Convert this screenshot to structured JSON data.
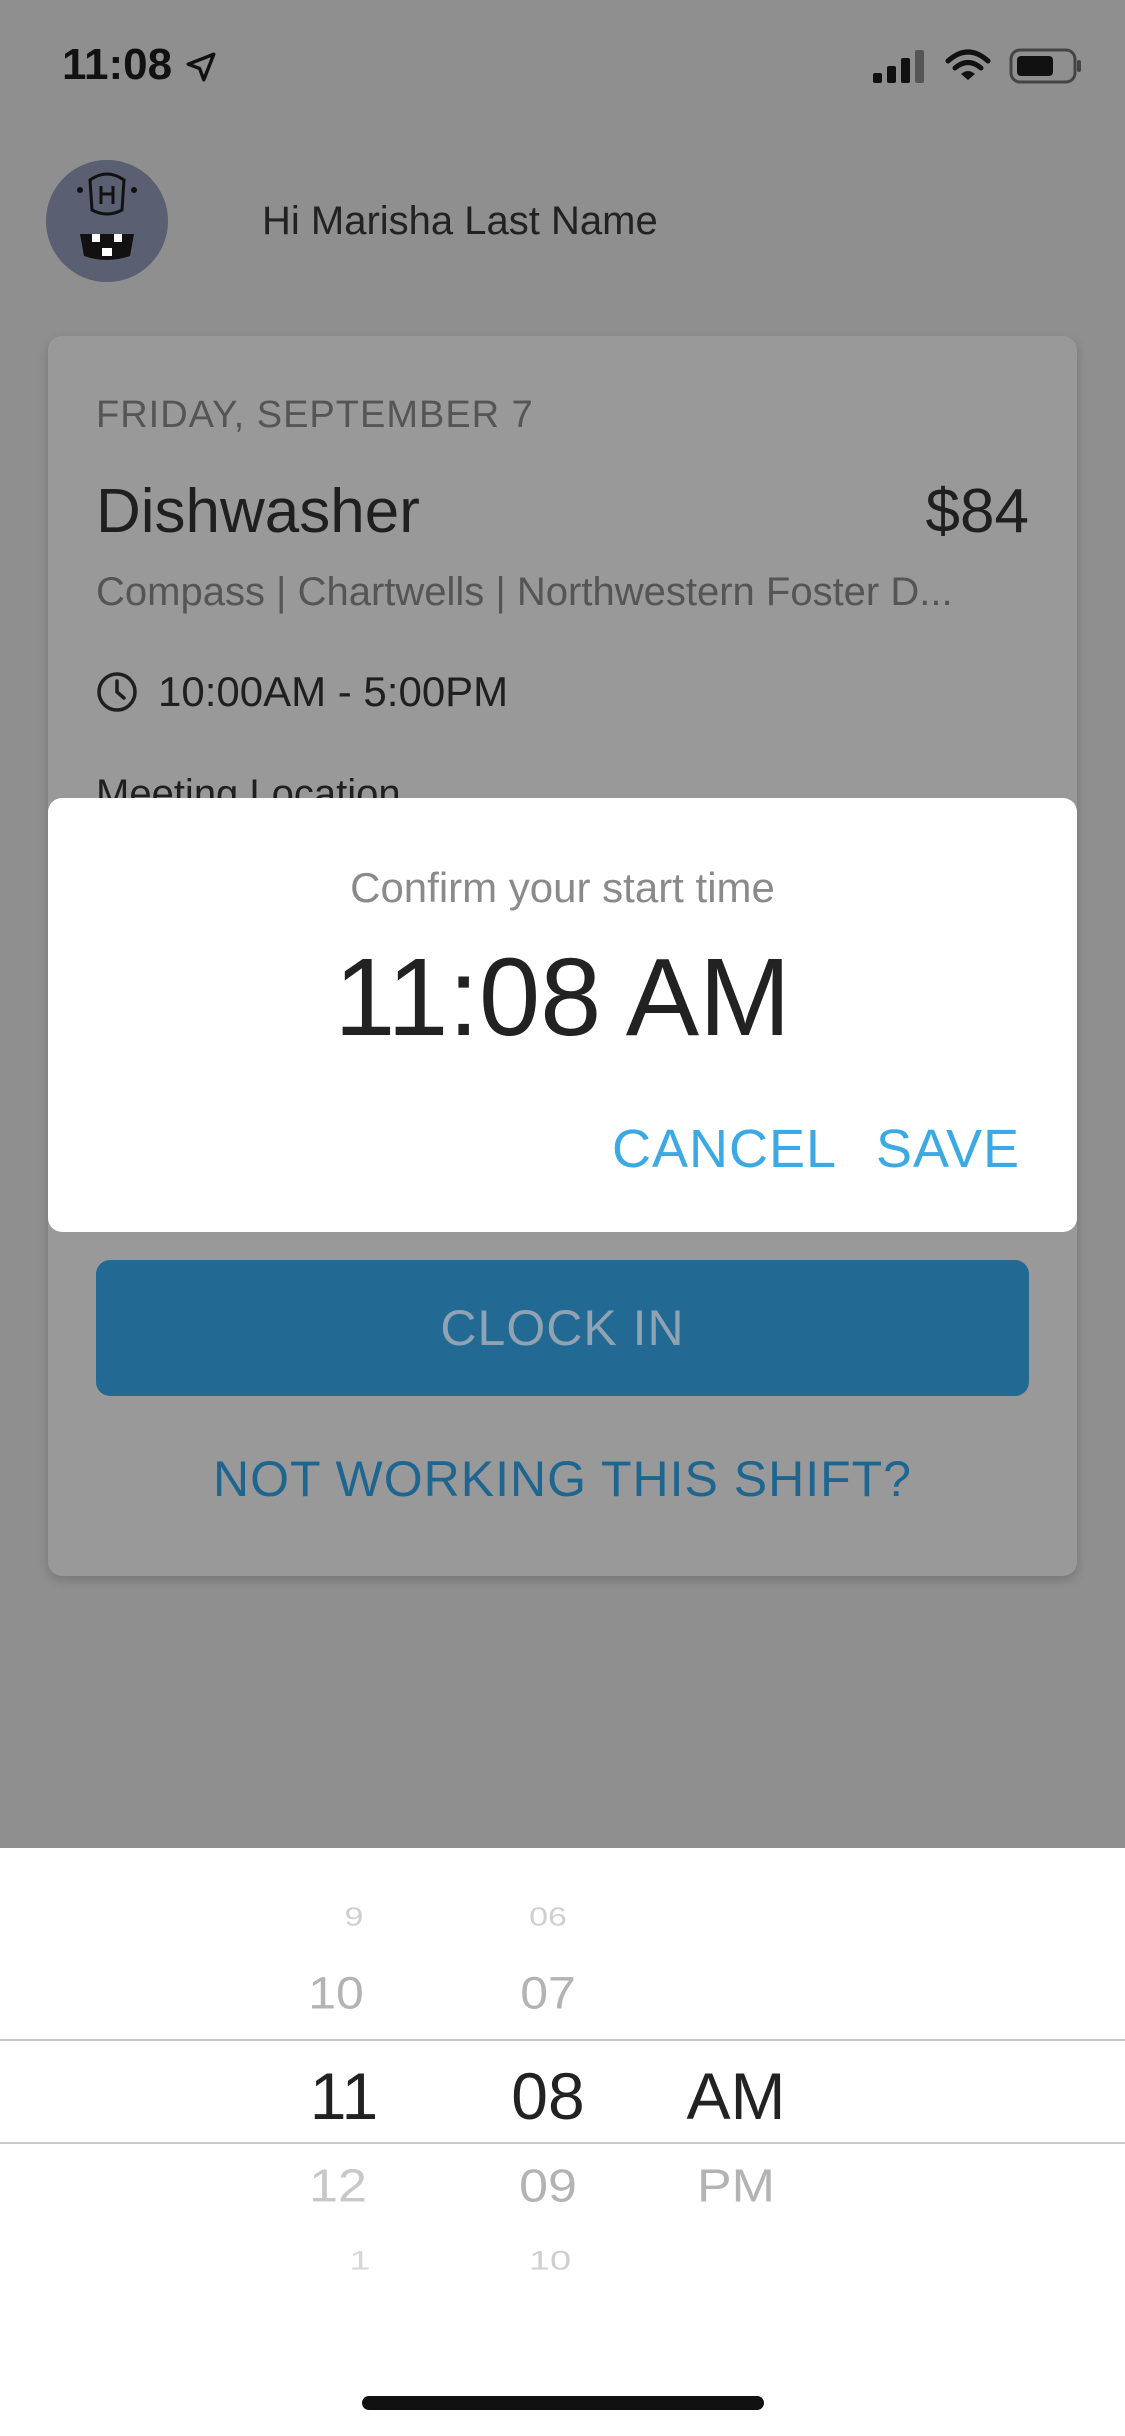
{
  "status_bar": {
    "time": "11:08"
  },
  "user": {
    "greeting": "Hi Marisha Last Name"
  },
  "shift": {
    "date": "FRIDAY, SEPTEMBER 7",
    "role": "Dishwasher",
    "pay": "$84",
    "company": "Compass | Chartwells | Northwestern Foster D...",
    "time_range": "10:00AM - 5:00PM",
    "meeting_location_label": "Meeting Location",
    "clock_in_label": "CLOCK IN",
    "not_working_label": "NOT WORKING THIS SHIFT?"
  },
  "dialog": {
    "title": "Confirm your start time",
    "time": "11:08 AM",
    "cancel_label": "CANCEL",
    "save_label": "SAVE"
  },
  "picker": {
    "hours": [
      "9",
      "10",
      "11",
      "12",
      "1"
    ],
    "minutes": [
      "06",
      "07",
      "08",
      "09",
      "10"
    ],
    "periods": [
      "AM",
      "PM"
    ],
    "selected": {
      "hour": "11",
      "minute": "08",
      "period": "AM"
    }
  },
  "colors": {
    "accent": "#3aa9e4",
    "clock_in_button": "#226a94",
    "overlay": "#8f8f8f"
  }
}
